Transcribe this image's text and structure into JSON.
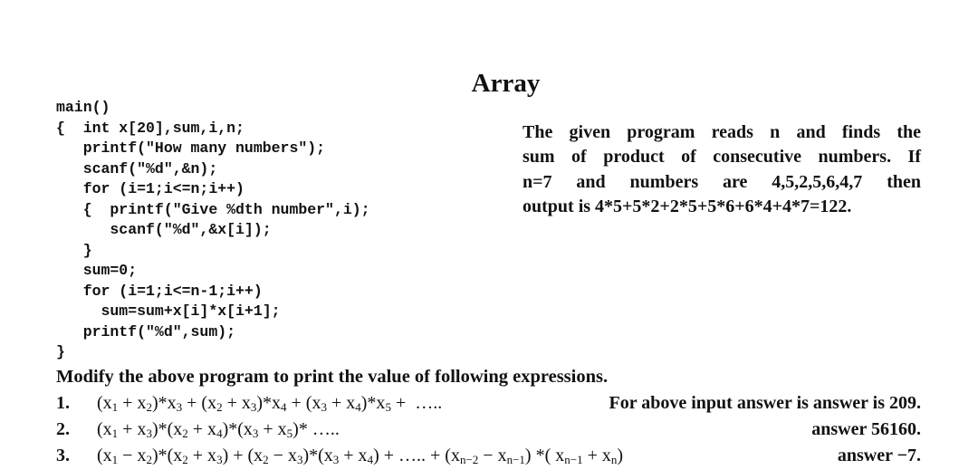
{
  "title": "Array",
  "code": {
    "lines": [
      "main()",
      "{  int x[20],sum,i,n;",
      "   printf(\"How many numbers\");",
      "   scanf(\"%d\",&n);",
      "   for (i=1;i<=n;i++)",
      "   {  printf(\"Give %dth number\",i);",
      "      scanf(\"%d\",&x[i]);",
      "   }",
      "   sum=0;",
      "   for (i=1;i<=n-1;i++)",
      "     sum=sum+x[i]*x[i+1];",
      "   printf(\"%d\",sum);",
      "}"
    ]
  },
  "description": {
    "lines": [
      "The given program reads n and finds the",
      "sum of product of consecutive numbers. If",
      "n=7 and numbers are 4,5,2,5,6,4,7 then",
      "output is 4*5+5*2+2*5+5*6+6*4+4*7=122."
    ]
  },
  "task": "Modify the above program to print the value of following expressions.",
  "expressions": [
    {
      "number": "1.",
      "formula_html": "(x<sub>1</sub> + x<sub>2</sub>)*x<sub>3</sub> + (x<sub>2</sub> + x<sub>3</sub>)*x<sub>4</sub> + (x<sub>3</sub> + x<sub>4</sub>)*x<sub>5</sub> + &nbsp;&hellip;..",
      "formula_text": "(x1 + x2)*x3 + (x2 + x3)*x4 + (x3 + x4)*x5 + …..",
      "answer": "For above input answer is answer is 209."
    },
    {
      "number": "2.",
      "formula_html": "(x<sub>1</sub> + x<sub>3</sub>)*(x<sub>2</sub> + x<sub>4</sub>)*(x<sub>3</sub> + x<sub>5</sub>)* &hellip;..",
      "formula_text": "(x1 + x3)*(x2 + x4)*(x3 + x5)* …..",
      "answer": "answer 56160."
    },
    {
      "number": "3.",
      "formula_html": "(x<sub>1</sub> &minus; x<sub>2</sub>)*(x<sub>2</sub> + x<sub>3</sub>) + (x<sub>2</sub> &minus; x<sub>3</sub>)*(x<sub>3</sub> + x<sub>4</sub>) + &hellip;.. + (x<sub>n&minus;2</sub> &minus; x<sub>n&minus;1</sub>) *( x<sub>n&minus;1</sub> + x<sub>n</sub>)",
      "formula_text": "(x1 − x2)*(x2 + x3) + (x2 − x3)*(x3 + x4) + ….. + (xn−2 − xn−1) *( xn−1 + xn)",
      "answer": "answer −7."
    }
  ]
}
